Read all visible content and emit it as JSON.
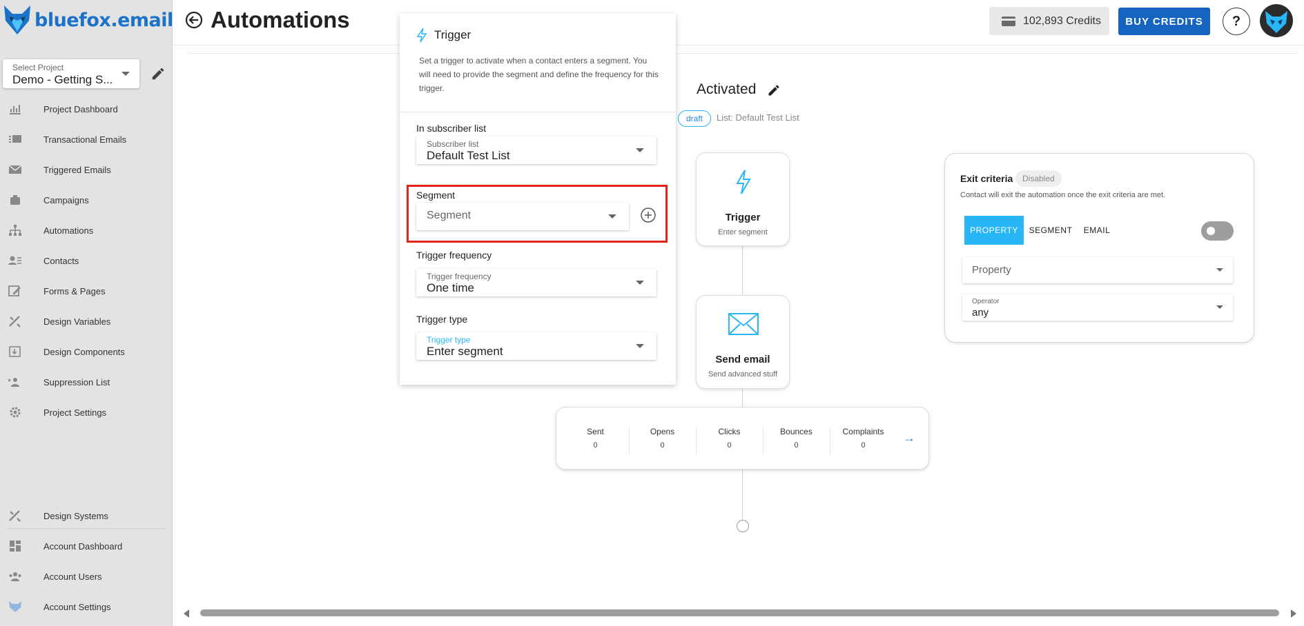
{
  "app": {
    "brand": "bluefox.email",
    "accent": "#1565c0",
    "highlight_color": "#e2231a"
  },
  "project": {
    "label": "Select Project",
    "value": "Demo - Getting S..."
  },
  "sidebar": {
    "items": [
      {
        "label": "Project Dashboard",
        "icon": "chart-icon"
      },
      {
        "label": "Transactional Emails",
        "icon": "mail-list-icon"
      },
      {
        "label": "Triggered Emails",
        "icon": "mail-icon"
      },
      {
        "label": "Campaigns",
        "icon": "campaign-icon"
      },
      {
        "label": "Automations",
        "icon": "automation-icon"
      },
      {
        "label": "Contacts",
        "icon": "contacts-icon"
      },
      {
        "label": "Forms & Pages",
        "icon": "forms-icon"
      },
      {
        "label": "Design Variables",
        "icon": "design-tools-icon"
      },
      {
        "label": "Design Components",
        "icon": "components-icon"
      },
      {
        "label": "Suppression List",
        "icon": "suppression-icon"
      },
      {
        "label": "Project Settings",
        "icon": "gear-icon"
      }
    ],
    "bottom_items": [
      {
        "label": "Design Systems",
        "icon": "design-tools-icon"
      },
      {
        "label": "Account Dashboard",
        "icon": "dashboard-icon"
      },
      {
        "label": "Account Users",
        "icon": "users-icon"
      },
      {
        "label": "Account Settings",
        "icon": "fox-icon"
      }
    ]
  },
  "header": {
    "title": "Automations",
    "credits": "102,893 Credits",
    "buy_label": "BUY CREDITS",
    "help_label": "?"
  },
  "flow": {
    "name": "Activated",
    "status": "draft",
    "list_info": "List: Default Test List",
    "trigger_node": {
      "title": "Trigger",
      "subtitle": "Enter segment"
    },
    "email_node": {
      "title": "Send email",
      "subtitle": "Send advanced stuff"
    },
    "stats": [
      {
        "label": "Sent",
        "value": "0"
      },
      {
        "label": "Opens",
        "value": "0"
      },
      {
        "label": "Clicks",
        "value": "0"
      },
      {
        "label": "Bounces",
        "value": "0"
      },
      {
        "label": "Complaints",
        "value": "0"
      }
    ],
    "stats_arrow": "→"
  },
  "exit_criteria": {
    "title": "Exit criteria",
    "badge": "Disabled",
    "description": "Contact will exit the automation once the exit criteria are met.",
    "tabs": [
      "PROPERTY",
      "SEGMENT",
      "EMAIL"
    ],
    "active_tab": "PROPERTY",
    "toggle_on": false,
    "property_placeholder": "Property",
    "operator_label": "Operator",
    "operator_value": "any"
  },
  "trigger_panel": {
    "title": "Trigger",
    "description": "Set a trigger to activate when a contact enters a segment. You will need to provide the segment and define the frequency for this trigger.",
    "subscriber_section": "In subscriber list",
    "subscriber_label": "Subscriber list",
    "subscriber_value": "Default Test List",
    "segment_section": "Segment",
    "segment_placeholder": "Segment",
    "frequency_section": "Trigger frequency",
    "frequency_label": "Trigger frequency",
    "frequency_value": "One time",
    "type_section": "Trigger type",
    "type_label": "Trigger type",
    "type_value": "Enter segment"
  }
}
